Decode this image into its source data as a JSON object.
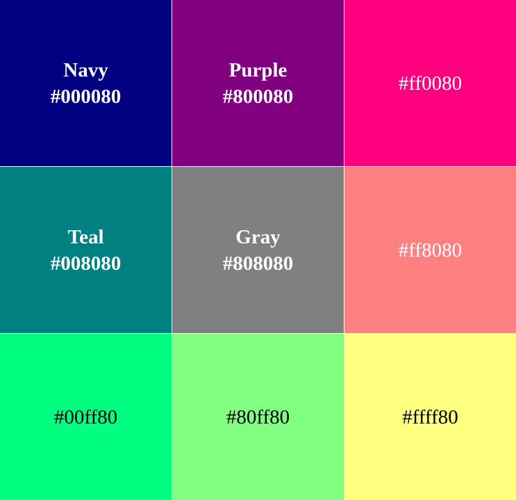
{
  "swatches": [
    {
      "name": "Navy",
      "hex": "#000080",
      "color": "#000080"
    },
    {
      "name": "Purple",
      "hex": "#800080",
      "color": "#800080"
    },
    {
      "name": "",
      "hex": "#ff0080",
      "color": "#ff0080"
    },
    {
      "name": "Teal",
      "hex": "#008080",
      "color": "#008080"
    },
    {
      "name": "Gray",
      "hex": "#808080",
      "color": "#808080"
    },
    {
      "name": "",
      "hex": "#ff8080",
      "color": "#ff8080"
    },
    {
      "name": "",
      "hex": "#00ff80",
      "color": "#00ff80"
    },
    {
      "name": "",
      "hex": "#80ff80",
      "color": "#80ff80"
    },
    {
      "name": "",
      "hex": "#ffff80",
      "color": "#ffff80"
    }
  ]
}
